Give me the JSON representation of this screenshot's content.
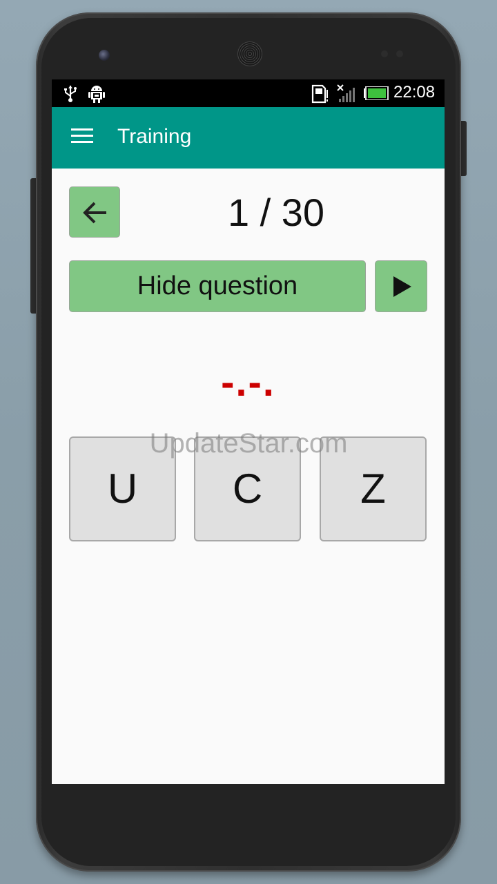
{
  "statusbar": {
    "time": "22:08",
    "icons": [
      "usb-icon",
      "android-debug-icon",
      "sd-card-icon",
      "no-signal-icon",
      "battery-full-icon"
    ]
  },
  "toolbar": {
    "title": "Training",
    "menu_icon": "hamburger-menu-icon"
  },
  "quiz": {
    "counter": "1 / 30",
    "hide_question_label": "Hide question",
    "morse_code": "-.-.",
    "answers": [
      "U",
      "C",
      "Z"
    ]
  },
  "watermark": "UpdateStar.com",
  "colors": {
    "toolbar": "#009688",
    "button_green": "#81c784",
    "morse_red": "#cc0000",
    "answer_bg": "#e0e0e0"
  }
}
